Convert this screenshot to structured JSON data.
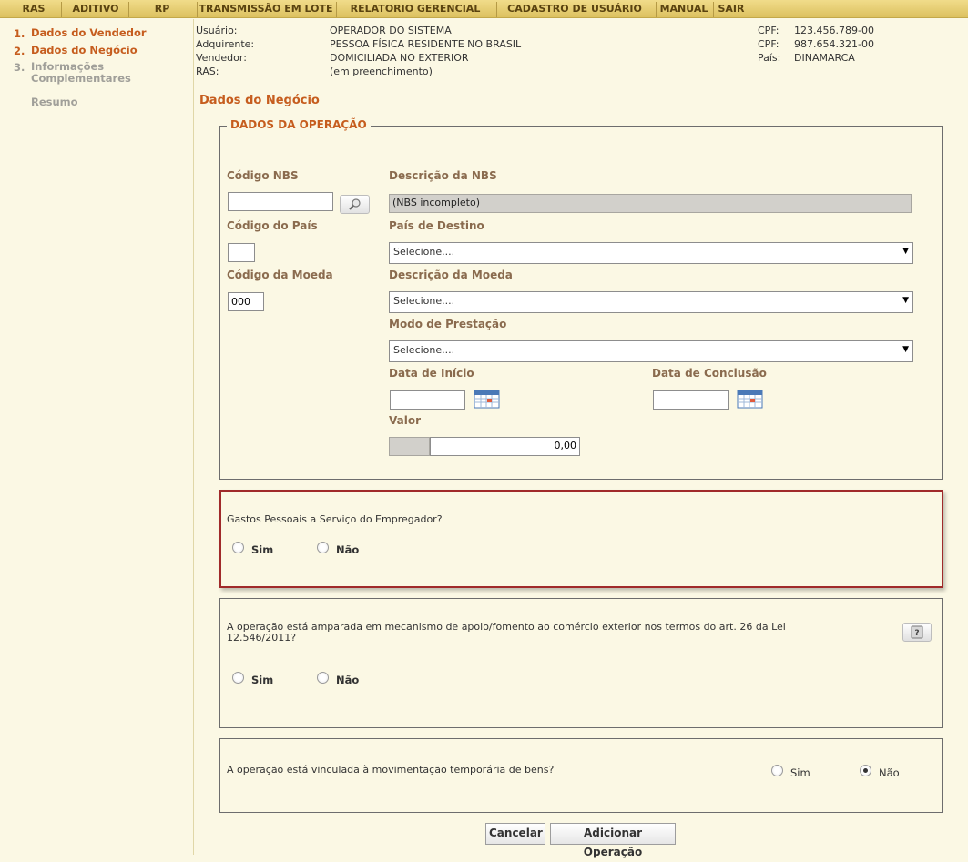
{
  "nav": [
    {
      "label": "RAS"
    },
    {
      "label": "ADITIVO"
    },
    {
      "label": "RP"
    },
    {
      "label": "TRANSMISSÃO EM LOTE"
    },
    {
      "label": "RELATORIO GERENCIAL"
    },
    {
      "label": "CADASTRO DE USUÁRIO"
    },
    {
      "label": "MANUAL"
    },
    {
      "label": "SAIR"
    }
  ],
  "steps": [
    {
      "num": "1.",
      "label": "Dados do Vendedor"
    },
    {
      "num": "2.",
      "label": "Dados do Negócio"
    },
    {
      "num": "3.",
      "label": "Informações Complementares"
    },
    {
      "num": "",
      "label": "Resumo"
    }
  ],
  "header": {
    "usuario_label": "Usuário:",
    "usuario_value": "OPERADOR DO SISTEMA",
    "adquirente_label": "Adquirente:",
    "adquirente_value": "PESSOA FÍSICA RESIDENTE NO BRASIL",
    "vendedor_label": "Vendedor:",
    "vendedor_value": "DOMICILIADA NO EXTERIOR",
    "ras_label": "RAS:",
    "ras_value": "(em preenchimento)",
    "cpf1_label": "CPF:",
    "cpf1_value": "123.456.789-00",
    "cpf2_label": "CPF:",
    "cpf2_value": "987.654.321-00",
    "pais_label": "País:",
    "pais_value": "DINAMARCA"
  },
  "page_title": "Dados do Negócio",
  "operacao": {
    "legend": "DADOS DA OPERAÇÃO",
    "codigo_nbs_label": "Código NBS",
    "codigo_nbs_value": "",
    "descricao_nbs_label": "Descrição da NBS",
    "descricao_nbs_value": "(NBS incompleto)",
    "codigo_pais_label": "Código do País",
    "codigo_pais_value": "",
    "pais_destino_label": "País de Destino",
    "pais_destino_value": "Selecione....",
    "codigo_moeda_label": "Código da Moeda",
    "codigo_moeda_value": "000",
    "descricao_moeda_label": "Descrição da Moeda",
    "descricao_moeda_value": "Selecione....",
    "modo_prestacao_label": "Modo de Prestação",
    "modo_prestacao_value": "Selecione....",
    "data_inicio_label": "Data de Início",
    "data_inicio_value": "",
    "data_conclusao_label": "Data de Conclusão",
    "data_conclusao_value": "",
    "valor_label": "Valor",
    "valor_value": "0,00"
  },
  "gastos": {
    "question": "Gastos Pessoais a Serviço do Empregador?",
    "sim": "Sim",
    "nao": "Não"
  },
  "fomento": {
    "question": "A operação está amparada em mecanismo de apoio/fomento ao comércio exterior nos termos do art. 26 da Lei 12.546/2011?",
    "sim": "Sim",
    "nao": "Não"
  },
  "temporaria": {
    "question": "A operação está vinculada à movimentação temporária de bens?",
    "sim": "Sim",
    "nao": "Não",
    "selected": "Não"
  },
  "actions": {
    "cancel": "Cancelar",
    "add": "Adicionar Operação"
  }
}
